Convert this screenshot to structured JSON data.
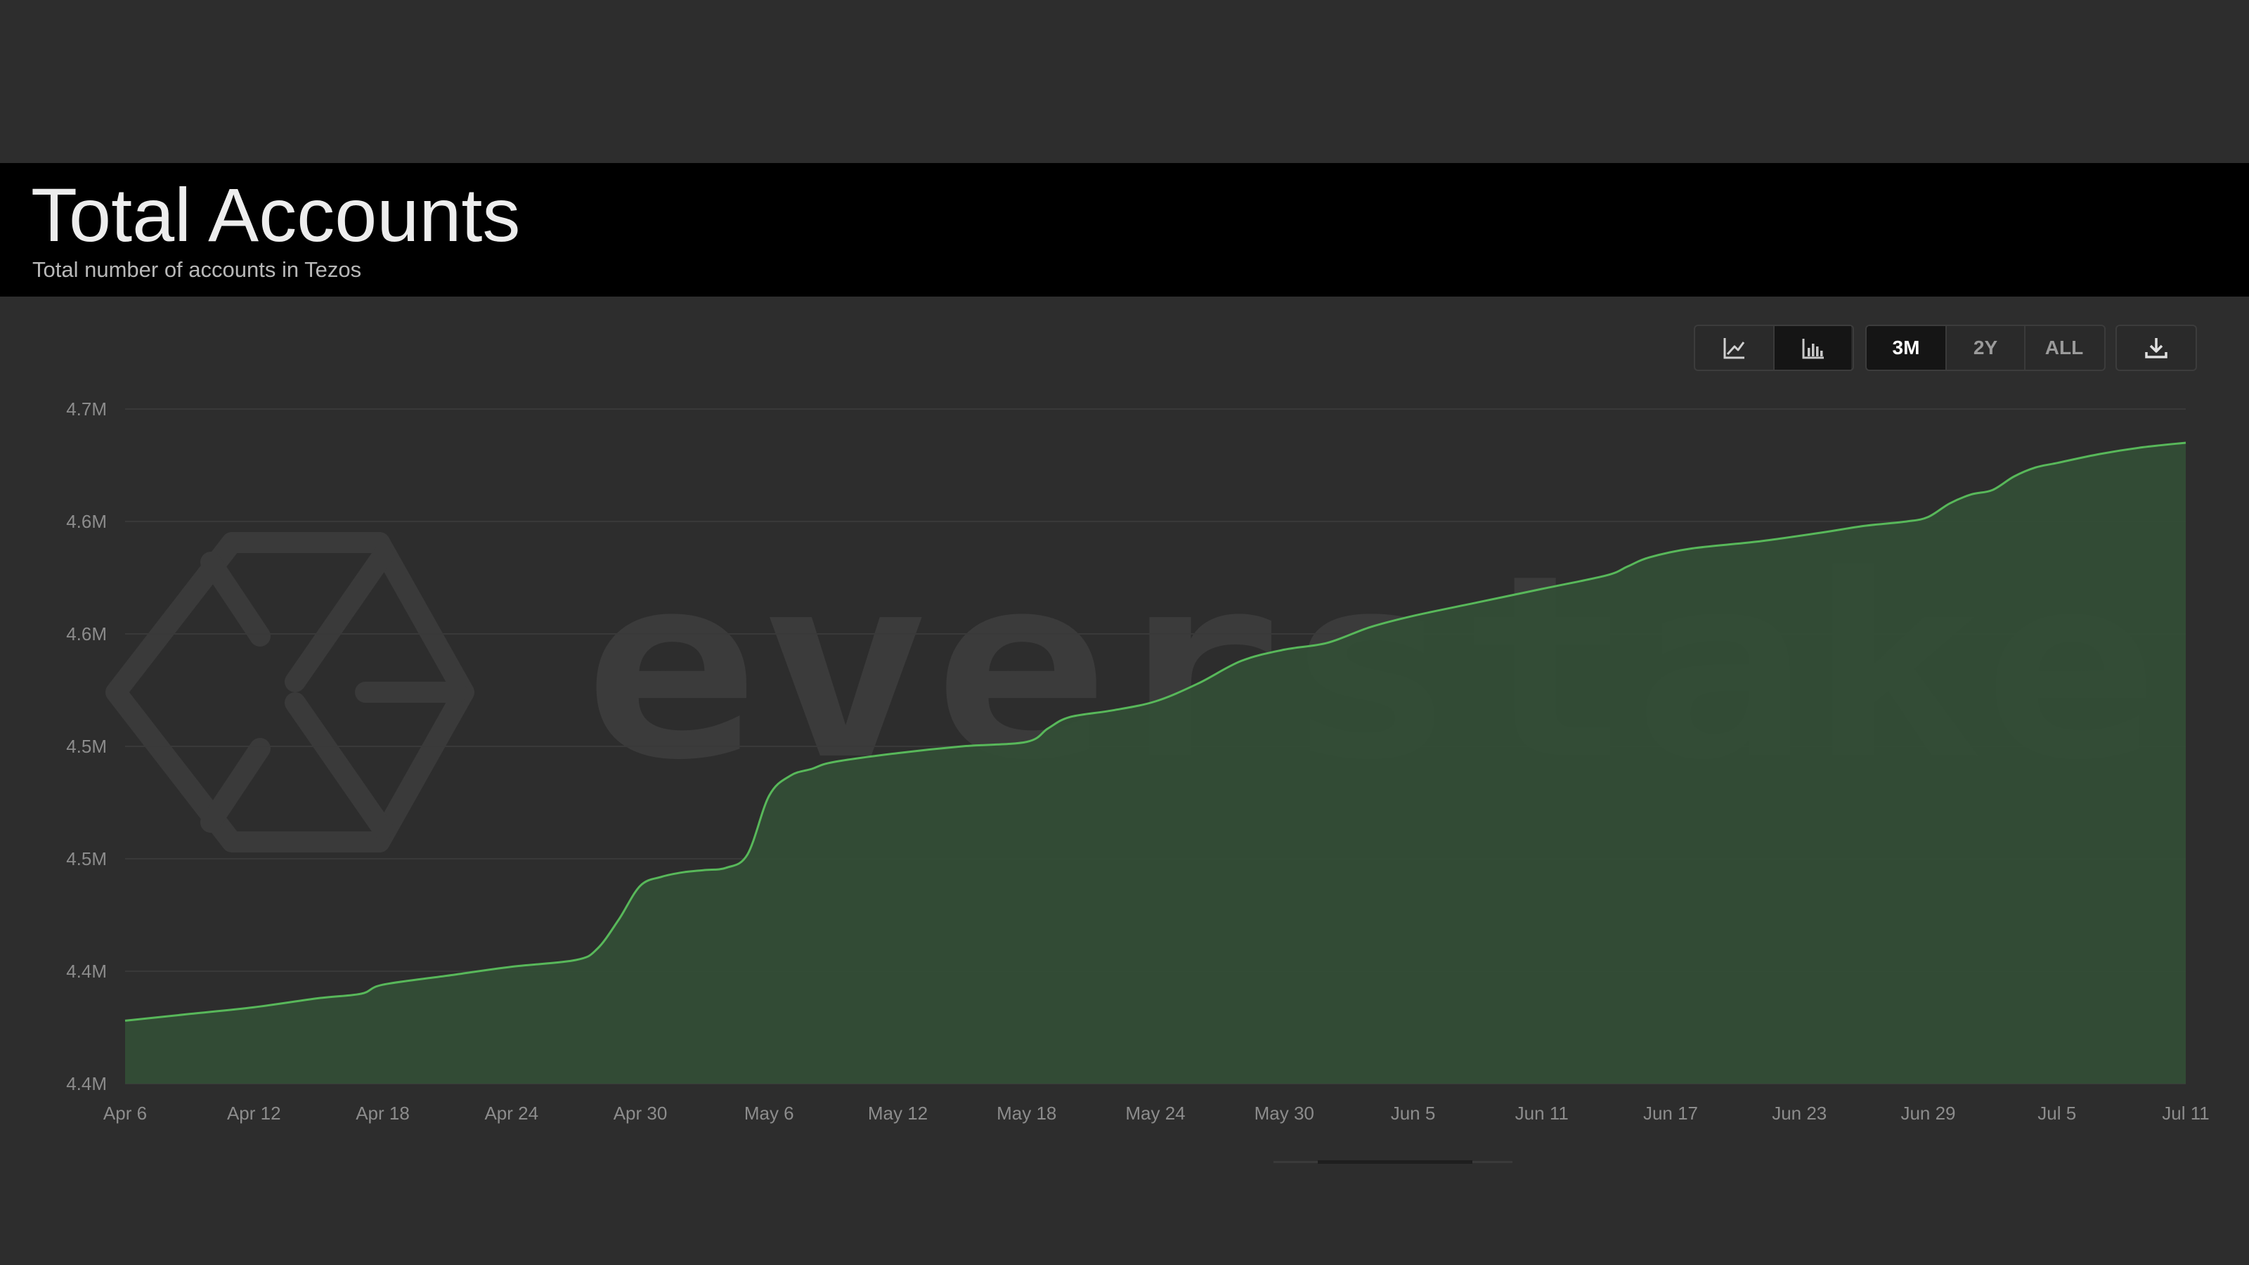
{
  "header": {
    "title": "Total Accounts",
    "subtitle": "Total number of accounts in Tezos"
  },
  "controls": {
    "chart_type_buttons": [
      {
        "icon": "line-chart-icon",
        "active": false
      },
      {
        "icon": "bar-chart-icon",
        "active": true
      }
    ],
    "range_buttons": [
      {
        "label": "3M",
        "active": true
      },
      {
        "label": "2Y",
        "active": false
      },
      {
        "label": "ALL",
        "active": false
      }
    ],
    "download_icon": "download-icon"
  },
  "watermark": {
    "text": "everstake"
  },
  "colors": {
    "background": "#2d2d2d",
    "header": "#000000",
    "line": "#58b85a",
    "area": "#334e36"
  },
  "chart_data": {
    "type": "area",
    "title": "Total Accounts",
    "subtitle": "Total number of accounts in Tezos",
    "xlabel": "",
    "ylabel": "",
    "y_tick_labels": [
      "4.4M",
      "4.4M",
      "4.5M",
      "4.5M",
      "4.6M",
      "4.6M",
      "4.7M"
    ],
    "ylim": [
      4.4,
      4.7
    ],
    "x_tick_labels": [
      "Apr 6",
      "Apr 12",
      "Apr 18",
      "Apr 24",
      "Apr 30",
      "May 6",
      "May 12",
      "May 18",
      "May 24",
      "May 30",
      "Jun 5",
      "Jun 11",
      "Jun 17",
      "Jun 23",
      "Jun 29",
      "Jul 5",
      "Jul 11"
    ],
    "grid": true,
    "legend": "none",
    "x": [
      "Apr 6",
      "Apr 9",
      "Apr 12",
      "Apr 15",
      "Apr 17",
      "Apr 18",
      "Apr 21",
      "Apr 24",
      "Apr 27",
      "Apr 28",
      "Apr 29",
      "Apr 30",
      "May 1",
      "May 2",
      "May 3",
      "May 4",
      "May 5",
      "May 6",
      "May 7",
      "May 8",
      "May 9",
      "May 12",
      "May 15",
      "May 18",
      "May 19",
      "May 20",
      "May 22",
      "May 24",
      "May 26",
      "May 28",
      "May 30",
      "Jun 1",
      "Jun 3",
      "Jun 5",
      "Jun 8",
      "Jun 11",
      "Jun 14",
      "Jun 15",
      "Jun 16",
      "Jun 18",
      "Jun 21",
      "Jun 24",
      "Jun 26",
      "Jun 28",
      "Jun 29",
      "Jun 30",
      "Jul 1",
      "Jul 2",
      "Jul 3",
      "Jul 4",
      "Jul 5",
      "Jul 7",
      "Jul 9",
      "Jul 11"
    ],
    "values": [
      4.428,
      4.431,
      4.434,
      4.438,
      4.44,
      4.444,
      4.448,
      4.452,
      4.455,
      4.46,
      4.473,
      4.488,
      4.492,
      4.494,
      4.495,
      4.496,
      4.502,
      4.528,
      4.537,
      4.54,
      4.543,
      4.547,
      4.55,
      4.552,
      4.558,
      4.563,
      4.566,
      4.57,
      4.578,
      4.588,
      4.593,
      4.596,
      4.603,
      4.608,
      4.614,
      4.62,
      4.626,
      4.63,
      4.634,
      4.638,
      4.641,
      4.645,
      4.648,
      4.65,
      4.652,
      4.658,
      4.662,
      4.664,
      4.67,
      4.674,
      4.676,
      4.68,
      4.683,
      4.685
    ]
  }
}
